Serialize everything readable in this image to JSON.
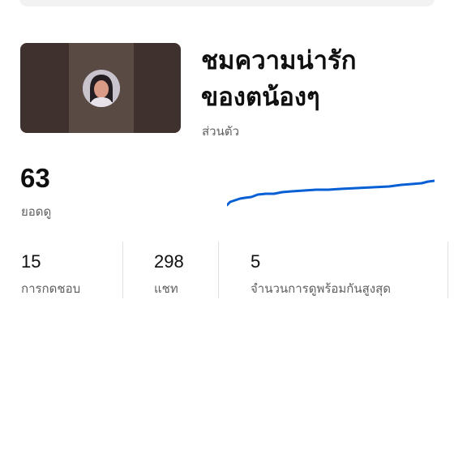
{
  "video": {
    "title_line1": "ชมความน่ารัก",
    "title_line2": "ของตน้องๆ",
    "subtitle": "ส่วนตัว"
  },
  "metrics": {
    "views_value": "63",
    "views_label": "ยอดดู",
    "stats": [
      {
        "value": "15",
        "label": "การกดชอบ"
      },
      {
        "value": "298",
        "label": "แชท"
      },
      {
        "value": "5",
        "label": "จำนวนการดูพร้อมกันสูงสุด"
      }
    ]
  },
  "colors": {
    "sparkline": "#065fd4",
    "thumbnail_bg": "#3f312d"
  },
  "icons": {
    "avatar": "profile-avatar"
  }
}
